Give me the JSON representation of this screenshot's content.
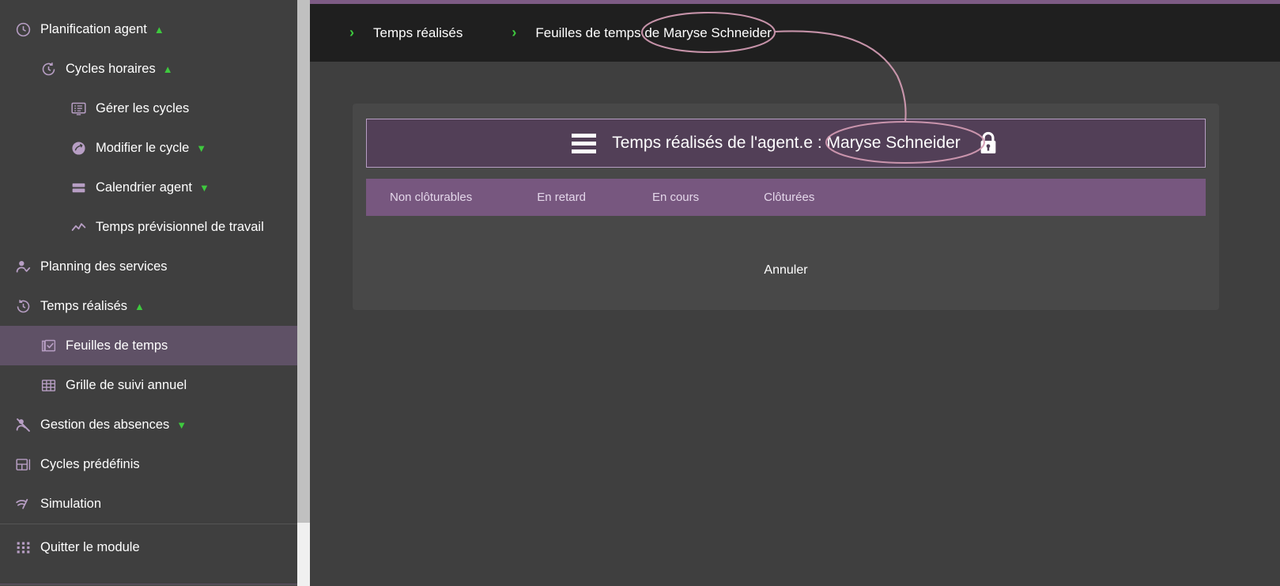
{
  "colors": {
    "accent_purple": "#7d5b84",
    "sidebar_bg": "#3f3f3f",
    "sidebar_active": "#5f5166",
    "breadcrumb_bg": "#1f1f1f",
    "dialog_header_bg": "#523f57",
    "tab_row_bg": "#77577f",
    "caret_green": "#3ec93e",
    "icon_purple": "#b79ec4",
    "annotation_pink": "#d49cb4"
  },
  "sidebar": {
    "items": [
      {
        "label": "Planification agent",
        "icon": "clock-icon",
        "level": 0,
        "caret": "up",
        "active": false
      },
      {
        "label": "Cycles horaires",
        "icon": "refresh-clock-icon",
        "level": 1,
        "caret": "up",
        "active": false
      },
      {
        "label": "Gérer les cycles",
        "icon": "list-screen-icon",
        "level": 2,
        "caret": "",
        "active": false
      },
      {
        "label": "Modifier le cycle",
        "icon": "gauge-circle-icon",
        "level": 2,
        "caret": "down",
        "active": false
      },
      {
        "label": "Calendrier agent",
        "icon": "rows-icon",
        "level": 2,
        "caret": "down",
        "active": false
      },
      {
        "label": "Temps prévisionnel de travail",
        "icon": "trend-line-icon",
        "level": 2,
        "caret": "",
        "active": false
      },
      {
        "label": "Planning des services",
        "icon": "user-check-icon",
        "level": 0,
        "caret": "",
        "active": false
      },
      {
        "label": "Temps réalisés",
        "icon": "history-clock-icon",
        "level": 0,
        "caret": "up",
        "active": false
      },
      {
        "label": "Feuilles de temps",
        "icon": "checked-sheets-icon",
        "level": 1,
        "caret": "",
        "active": true
      },
      {
        "label": "Grille de suivi annuel",
        "icon": "grid-table-icon",
        "level": 1,
        "caret": "",
        "active": false
      },
      {
        "label": "Gestion des absences",
        "icon": "absence-person-icon",
        "level": 0,
        "caret": "down",
        "active": false
      },
      {
        "label": "Cycles prédéfinis",
        "icon": "layout-panel-icon",
        "level": 0,
        "caret": "",
        "active": false
      },
      {
        "label": "Simulation",
        "icon": "signal-wave-icon",
        "level": 0,
        "caret": "",
        "active": false
      }
    ],
    "footer": {
      "label": "Quitter le module",
      "icon": "grid-dots-icon"
    }
  },
  "breadcrumb": {
    "separator": "›",
    "crumbs": [
      {
        "label": "Temps réalisés"
      },
      {
        "label": "Feuilles de temps de Maryse Schneider"
      }
    ]
  },
  "dialog": {
    "menu_icon": "hamburger-icon",
    "title": "Temps réalisés de l'agent.e : Maryse Schneider",
    "lock_icon": "lock-closed-icon",
    "tabs": [
      {
        "label": "Non clôturables",
        "selected": false
      },
      {
        "label": "En retard",
        "selected": false
      },
      {
        "label": "En cours",
        "selected": false
      },
      {
        "label": "Clôturées",
        "selected": false
      }
    ],
    "cancel_label": "Annuler"
  },
  "annotation": {
    "highlight_breadcrumb_text": "Maryse Schneider",
    "highlight_dialog_text": "Maryse Schneider"
  }
}
